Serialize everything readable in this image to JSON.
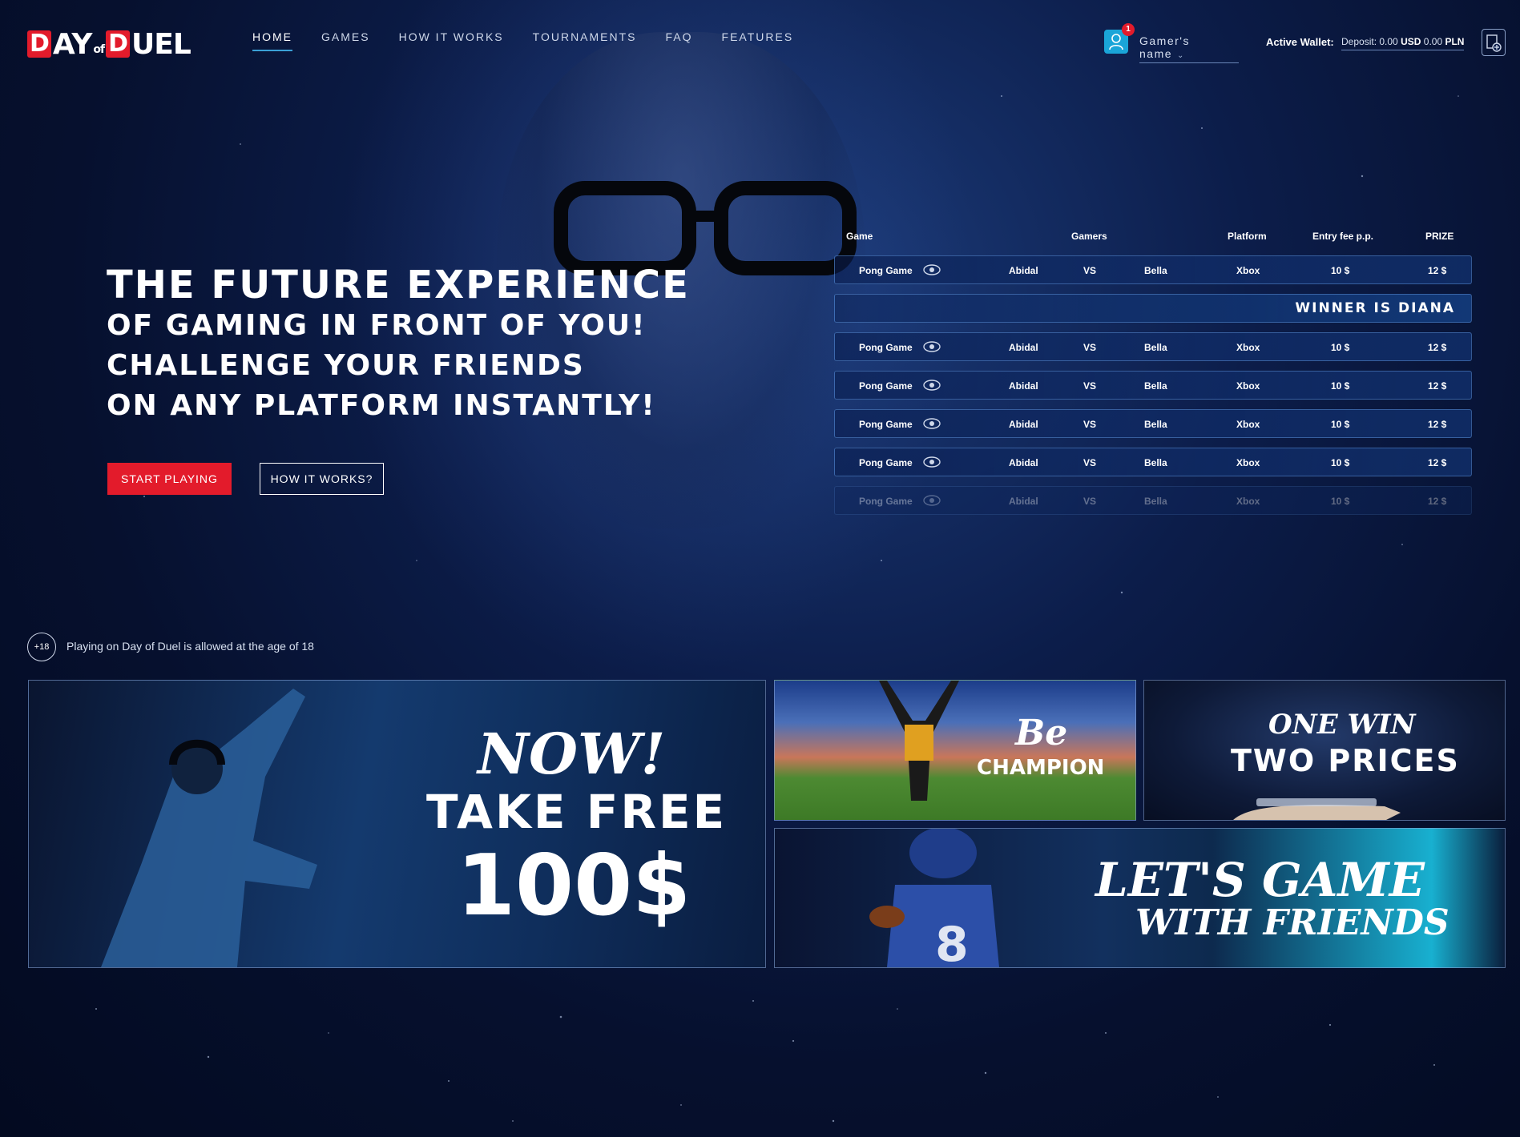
{
  "header": {
    "logo_text": "DAY of DUEL",
    "nav": [
      {
        "label": "HOME",
        "active": true
      },
      {
        "label": "GAMES",
        "active": false
      },
      {
        "label": "HOW IT WORKS",
        "active": false
      },
      {
        "label": "TOURNAMENTS",
        "active": false
      },
      {
        "label": "FAQ",
        "active": false
      },
      {
        "label": "FEATURES",
        "active": false
      }
    ],
    "notification_count": "1",
    "gamer_name": "Gamer's name",
    "wallet_label": "Active Wallet:",
    "wallet_prefix": "Deposit:",
    "wallet_usd_amount": "0.00",
    "wallet_usd_unit": "USD",
    "wallet_pln_amount": "0.00",
    "wallet_pln_unit": "PLN"
  },
  "hero": {
    "headline_1": "THE FUTURE EXPERIENCE",
    "headline_2": "OF GAMING IN FRONT OF YOU!",
    "headline_3": "CHALLENGE YOUR FRIENDS",
    "headline_4": "ON ANY PLATFORM INSTANTLY!",
    "start_button": "START PLAYING",
    "how_button": "HOW IT WORKS?"
  },
  "duels": {
    "columns": {
      "game": "Game",
      "gamers": "Gamers",
      "platform": "Platform",
      "entry_fee": "Entry fee p.p.",
      "prize": "PRIZE"
    },
    "rows": [
      {
        "game": "Pong Game",
        "player1": "Abidal",
        "vs": "VS",
        "player2": "Bella",
        "platform": "Xbox",
        "fee": "10 $",
        "prize": "12 $"
      },
      {
        "game": "Pong Game",
        "player1": "Abidal",
        "vs": "VS",
        "player2": "Bella",
        "platform": "Xbox",
        "fee": "10 $",
        "prize": "12 $"
      },
      {
        "game": "Pong Game",
        "player1": "Abidal",
        "vs": "VS",
        "player2": "Bella",
        "platform": "Xbox",
        "fee": "10 $",
        "prize": "12 $"
      },
      {
        "game": "Pong Game",
        "player1": "Abidal",
        "vs": "VS",
        "player2": "Bella",
        "platform": "Xbox",
        "fee": "10 $",
        "prize": "12 $"
      },
      {
        "game": "Pong Game",
        "player1": "Abidal",
        "vs": "VS",
        "player2": "Bella",
        "platform": "Xbox",
        "fee": "10 $",
        "prize": "12 $"
      },
      {
        "game": "Pong Game",
        "player1": "Abidal",
        "vs": "VS",
        "player2": "Bella",
        "platform": "Xbox",
        "fee": "10 $",
        "prize": "12 $"
      }
    ],
    "winner_text": "WINNER IS DIANA"
  },
  "age_notice": {
    "icon_text": "+18",
    "text": "Playing on Day of Duel is allowed at the age of 18"
  },
  "promos": {
    "big_now": "NOW!",
    "big_take": "TAKE FREE",
    "big_amount": "100$",
    "champ_be": "Be",
    "champ_word": "CHAMPION",
    "two_one_win": "ONE WIN",
    "two_prices": "TWO PRICES",
    "friends_line1": "LET'S GAME",
    "friends_line2": "WITH FRIENDS"
  },
  "colors": {
    "accent_red": "#e31b2b",
    "accent_blue": "#1aa5d8",
    "background": "#06102e"
  }
}
